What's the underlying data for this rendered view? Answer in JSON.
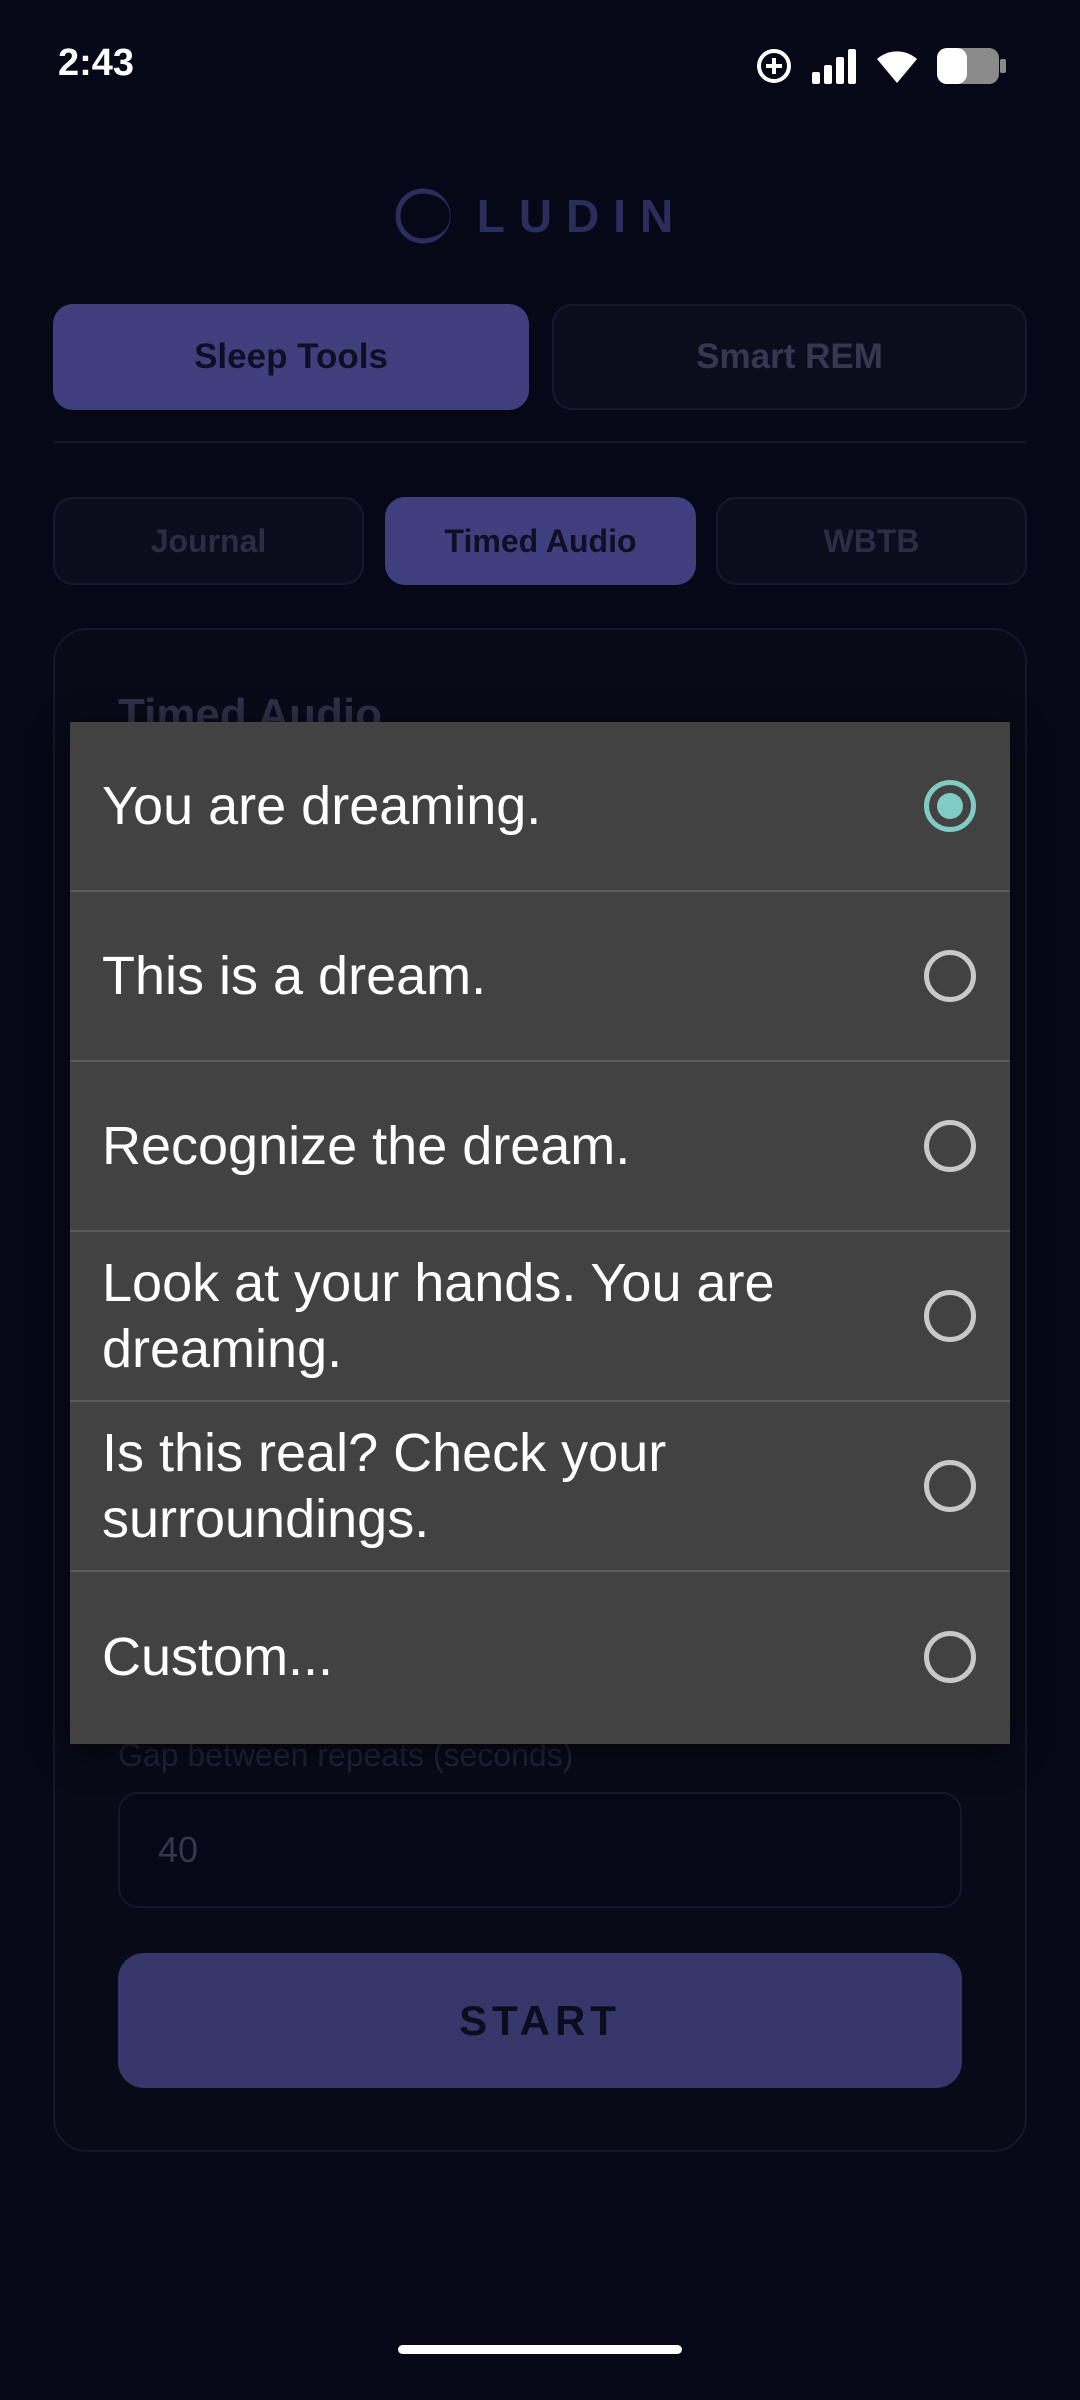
{
  "status_bar": {
    "time": "2:43"
  },
  "app": {
    "logo_text": "LUDIN"
  },
  "main_tabs": [
    {
      "label": "Sleep Tools",
      "active": true
    },
    {
      "label": "Smart REM",
      "active": false
    }
  ],
  "sub_tabs": [
    {
      "label": "Journal",
      "active": false
    },
    {
      "label": "Timed Audio",
      "active": true
    },
    {
      "label": "WBTB",
      "active": false
    }
  ],
  "card": {
    "title": "Timed Audio",
    "gap_label": "Gap between repeats (seconds)",
    "gap_value": "40",
    "start_label": "START"
  },
  "dialog": {
    "selected_index": 0,
    "options": [
      "You are dreaming.",
      "This is a dream.",
      "Recognize the dream.",
      "Look at your hands. You are dreaming.",
      "Is this real? Check your surroundings.",
      "Custom..."
    ]
  },
  "colors": {
    "background": "#070817",
    "accent": "#3f3f7e",
    "radio_selected": "#80cbc4",
    "dialog_bg": "#424242"
  }
}
